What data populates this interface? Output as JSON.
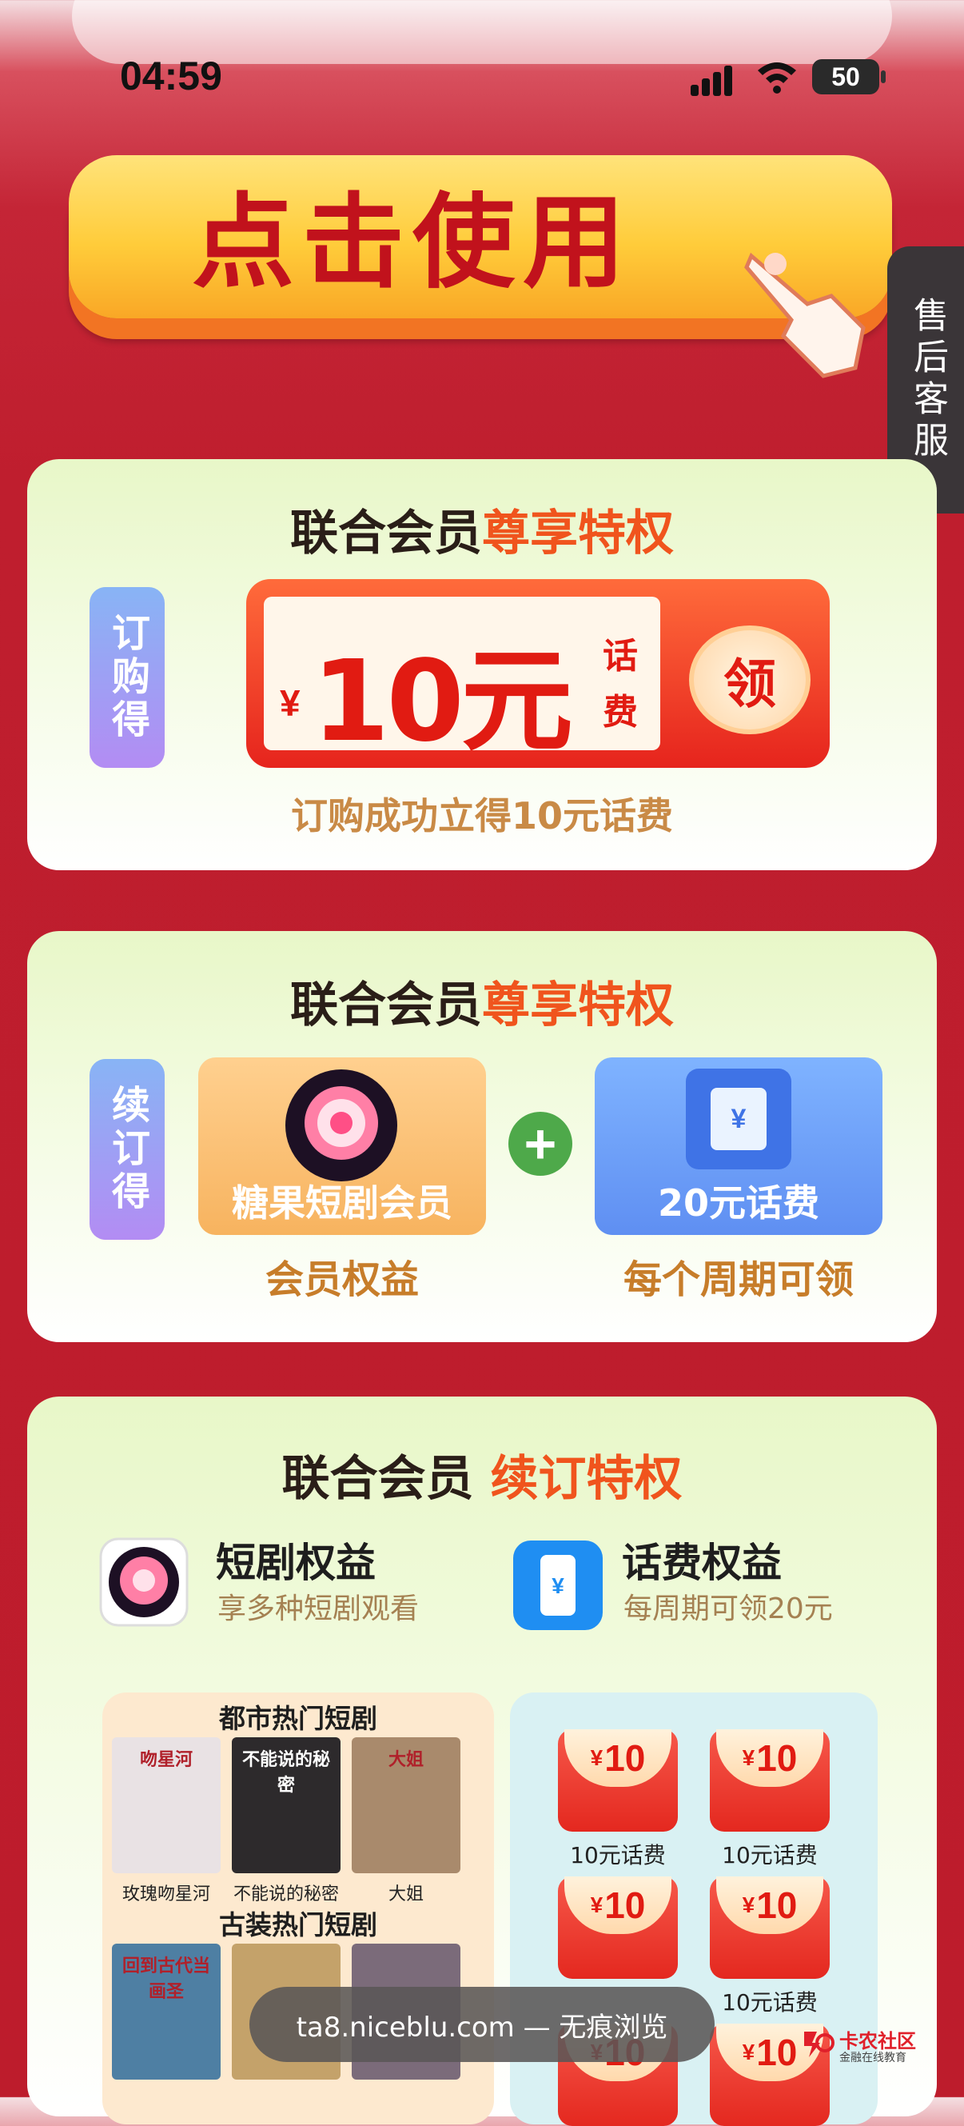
{
  "status_bar": {
    "time": "04:59",
    "battery": "50"
  },
  "cta": {
    "label": "点击使用"
  },
  "service_tab": {
    "label": "售后客服"
  },
  "card1": {
    "title_dark": "联合会员",
    "title_accent": "尊享特权",
    "side_tag": "订购得",
    "coupon": {
      "currency": "¥",
      "amount": "10元",
      "unit": "话费",
      "claim": "领"
    },
    "note": "订购成功立得10元话费"
  },
  "card2": {
    "title_dark": "联合会员",
    "title_accent": "尊享特权",
    "side_tag": "续订得",
    "member": {
      "label": "糖果短剧会员",
      "caption": "会员权益"
    },
    "plus": "+",
    "phone": {
      "icon_text": "¥",
      "label": "20元话费",
      "caption": "每个周期可领"
    }
  },
  "card3": {
    "title_dark": "联合会员",
    "title_accent": "续订特权",
    "drama": {
      "title": "短剧权益",
      "subtitle": "享多种短剧观看"
    },
    "phone": {
      "title": "话费权益",
      "subtitle": "每周期可领20元"
    },
    "urban_header": "都市热门短剧",
    "urban": [
      {
        "caption": "玫瑰吻星河",
        "poster_text": "吻星河",
        "color": "#e9e2e4"
      },
      {
        "caption": "不能说的秘密",
        "poster_text": "不能说的秘密",
        "color": "#2d2a2c"
      },
      {
        "caption": "大姐",
        "poster_text": "大姐",
        "color": "#a98a6c"
      }
    ],
    "ancient_header": "古装热门短剧",
    "ancient": [
      {
        "poster_text": "回到古代当画圣",
        "color": "#4e7fa3"
      },
      {
        "poster_text": "",
        "color": "#c4a26a"
      },
      {
        "poster_text": "",
        "color": "#7b6b7a"
      }
    ],
    "packets": [
      {
        "currency": "¥",
        "amount": "10",
        "caption": "10元话费"
      },
      {
        "currency": "¥",
        "amount": "10",
        "caption": "10元话费"
      },
      {
        "currency": "¥",
        "amount": "10",
        "caption": ""
      },
      {
        "currency": "¥",
        "amount": "10",
        "caption": "10元话费"
      },
      {
        "currency": "¥",
        "amount": "10",
        "caption": ""
      },
      {
        "currency": "¥",
        "amount": "10",
        "caption": ""
      }
    ]
  },
  "toast": {
    "text": "ta8.niceblu.com — 无痕浏览"
  },
  "watermark": {
    "title": "卡农社区",
    "subtitle": "金融在线教育"
  }
}
